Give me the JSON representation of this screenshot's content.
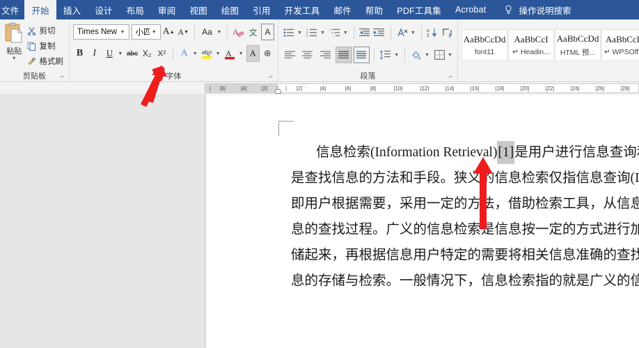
{
  "app": {
    "accent_color": "#2b579a",
    "ribbon_bg": "#f3f3f3"
  },
  "tabs": [
    {
      "label": "文件",
      "active": false
    },
    {
      "label": "开始",
      "active": true
    },
    {
      "label": "插入",
      "active": false
    },
    {
      "label": "设计",
      "active": false
    },
    {
      "label": "布局",
      "active": false
    },
    {
      "label": "审阅",
      "active": false
    },
    {
      "label": "视图",
      "active": false
    },
    {
      "label": "绘图",
      "active": false
    },
    {
      "label": "引用",
      "active": false
    },
    {
      "label": "开发工具",
      "active": false
    },
    {
      "label": "邮件",
      "active": false
    },
    {
      "label": "帮助",
      "active": false
    },
    {
      "label": "PDF工具集",
      "active": false
    },
    {
      "label": "Acrobat",
      "active": false
    }
  ],
  "tellme": {
    "icon": "lightbulb-icon",
    "label": "操作说明搜索"
  },
  "clipboard": {
    "group_label": "剪贴板",
    "paste_label": "粘贴",
    "items": [
      {
        "label": "剪切",
        "icon": "scissors-icon"
      },
      {
        "label": "复制",
        "icon": "copy-icon"
      },
      {
        "label": "格式刷",
        "icon": "format-painter-icon"
      }
    ]
  },
  "font": {
    "group_label": "字体",
    "font_name": "Times New Ro",
    "font_size": "小四",
    "grow_label": "A",
    "shrink_label": "A",
    "change_case_label": "Aa",
    "clear_format_label": "A",
    "phonetic_label": "文",
    "char_border_label": "A",
    "bold_label": "B",
    "italic_label": "I",
    "underline_label": "U",
    "strike_label": "abc",
    "subscript_label": "X₂",
    "superscript_label": "X²",
    "text_effects_label": "A",
    "highlight_label": "ab",
    "font_color_label": "A",
    "shading_label": "A",
    "enclose_label": "⊕"
  },
  "paragraph": {
    "group_label": "段落",
    "bullets_label": "☰",
    "numbering_label": "☰",
    "multilevel_label": "☰",
    "decrease_indent_label": "⇤",
    "increase_indent_label": "⇥",
    "sort_label": "A↓",
    "marks_label": "¶",
    "align_left_label": "≡",
    "align_center_label": "≡",
    "align_right_label": "≡",
    "justify_label": "≡",
    "distribute_label": "▤",
    "line_spacing_label": "↕",
    "shading_label": "◨",
    "borders_label": "⊞"
  },
  "styles": [
    {
      "preview": "AaBbCcDd",
      "name": "font11"
    },
    {
      "preview": "AaBbCcI",
      "name": "↵ Headin..."
    },
    {
      "preview": "AaBbCcDd",
      "name": "HTML 预..."
    },
    {
      "preview": "AaBbCcD",
      "name": "↵ WPSOff..."
    }
  ],
  "ruler": {
    "left_ticks": [
      "6",
      "4",
      "2"
    ],
    "right_ticks": [
      "2",
      "4",
      "6",
      "8",
      "10",
      "12",
      "14",
      "16",
      "18",
      "20",
      "22",
      "24",
      "26",
      "28",
      "30"
    ]
  },
  "document": {
    "lines": [
      {
        "pre": "信息检索(Information Retrieval)",
        "sel": "[1]",
        "post": "是用户进行信息查询和获取的主"
      },
      {
        "pre": "是查找信息的方法和手段。狭义的信息检索仅指信息查询(Information",
        "sel": "",
        "post": ""
      },
      {
        "pre": "即用户根据需要，采用一定的方法，借助检索工具，从信息集合中找出",
        "sel": "",
        "post": ""
      },
      {
        "pre": "息的查找过程。广义的信息检索是信息按一定的方式进行加工、整理、",
        "sel": "",
        "post": ""
      },
      {
        "pre": "储起来，再根据信息用户特定的需要将相关信息准确的查找出来的过程",
        "sel": "",
        "post": ""
      },
      {
        "pre": "息的存储与检索。一般情况下，信息检索指的就是广义的信息检索。",
        "sel": "",
        "post": ""
      }
    ]
  },
  "annotations": [
    {
      "name": "arrow-to-superscript",
      "color": "#ee1c1c"
    },
    {
      "name": "arrow-to-selection",
      "color": "#ee1c1c"
    }
  ]
}
